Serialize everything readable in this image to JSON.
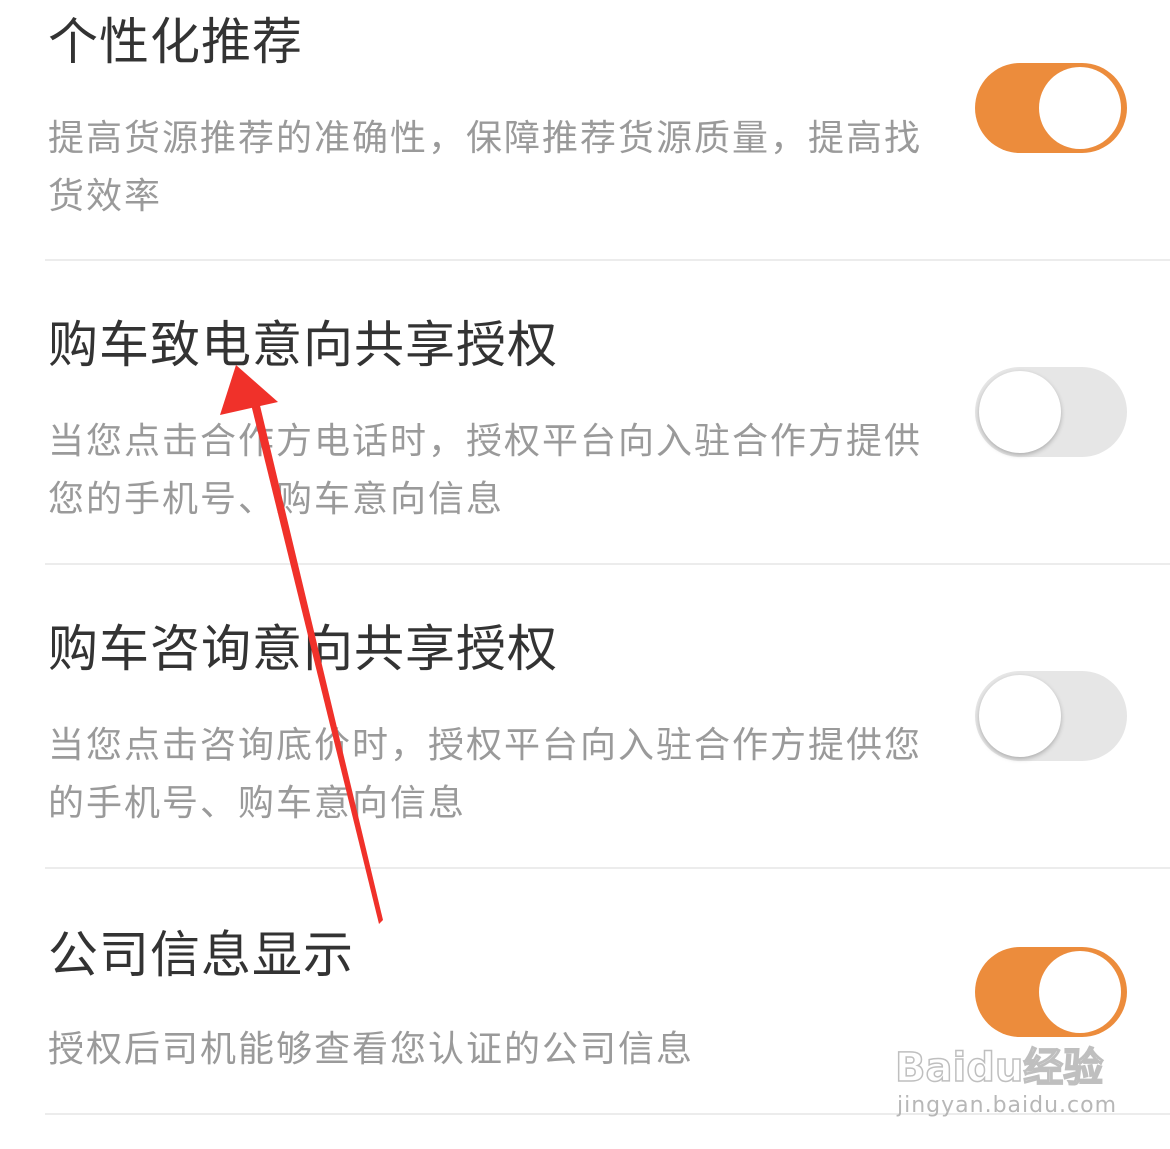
{
  "settings": [
    {
      "title": "个性化推荐",
      "description": "提高货源推荐的准确性，保障推荐货源质量，提高找货效率",
      "enabled": true
    },
    {
      "title": "购车致电意向共享授权",
      "description": "当您点击合作方电话时，授权平台向入驻合作方提供您的手机号、购车意向信息",
      "enabled": false
    },
    {
      "title": "购车咨询意向共享授权",
      "description": "当您点击咨询底价时，授权平台向入驻合作方提供您的手机号、购车意向信息",
      "enabled": false
    },
    {
      "title": "公司信息显示",
      "description": "授权后司机能够查看您认证的公司信息",
      "enabled": true
    }
  ],
  "watermark": {
    "logo": "Baidu经验",
    "url": "jingyan.baidu.com"
  },
  "colors": {
    "toggle_on": "#ec8c3c",
    "toggle_off": "#e6e6e6",
    "annotation_arrow": "#f0312a"
  }
}
